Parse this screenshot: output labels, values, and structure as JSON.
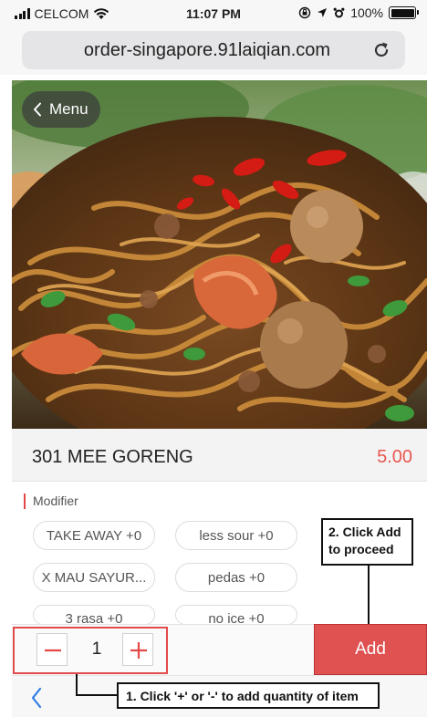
{
  "status_bar": {
    "carrier": "CELCOM",
    "time": "11:07 PM",
    "battery": "100%",
    "battery_level": 1.0,
    "icons": [
      "signal-icon",
      "wifi-icon",
      "lock-rotation-icon",
      "location-icon",
      "alarm-icon",
      "battery-icon"
    ]
  },
  "browser": {
    "url": "order-singapore.91laiqian.com",
    "reload_icon": "reload-icon"
  },
  "header": {
    "back_label": "Menu",
    "back_icon": "chevron-left-icon"
  },
  "product": {
    "name": "301 MEE GORENG",
    "price": "5.00"
  },
  "modifiers": {
    "title": "Modifier",
    "options": [
      "TAKE AWAY +0",
      "less sour +0",
      "X MAU SAYUR...",
      "pedas +0",
      "3 rasa +0",
      "no ice +0"
    ]
  },
  "order": {
    "minus_icon": "minus-icon",
    "plus_icon": "plus-icon",
    "quantity": "1",
    "add_label": "Add"
  },
  "annotations": {
    "step2_line1": "2. Click Add",
    "step2_line2": "to proceed",
    "step1": "1. Click '+' or '-' to add quantity of item"
  },
  "nav": {
    "back_icon": "chevron-left-icon"
  },
  "colors": {
    "accent": "#e8574f",
    "add_button": "#e05151",
    "annotation_red": "#e34a4a"
  }
}
